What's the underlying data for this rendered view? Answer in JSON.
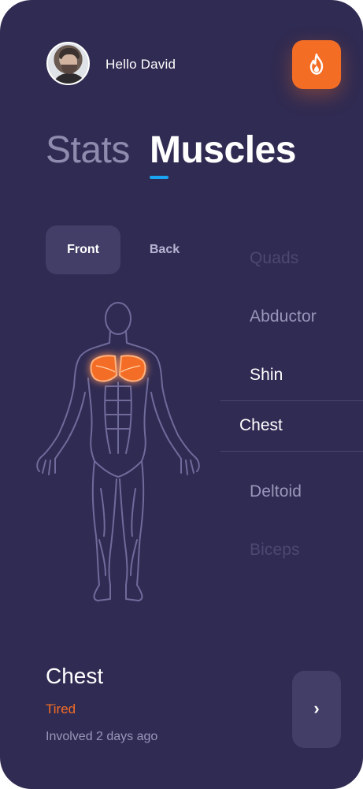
{
  "header": {
    "greeting": "Hello David",
    "fire_icon": "fire-icon",
    "accent_color": "#f46d25"
  },
  "tabs": [
    {
      "label": "Stats",
      "active": false
    },
    {
      "label": "Muscles",
      "active": true
    }
  ],
  "view_toggle": {
    "front_label": "Front",
    "back_label": "Back",
    "selected": "Front"
  },
  "muscle_list": {
    "items": [
      "Quads",
      "Abductor",
      "Shin",
      "Chest",
      "Deltoid",
      "Biceps"
    ],
    "selected": "Chest"
  },
  "info": {
    "title": "Chest",
    "status": "Tired",
    "subtitle": "Involved 2 days ago",
    "next_icon": "chevron-right-icon",
    "next_glyph": "›"
  }
}
